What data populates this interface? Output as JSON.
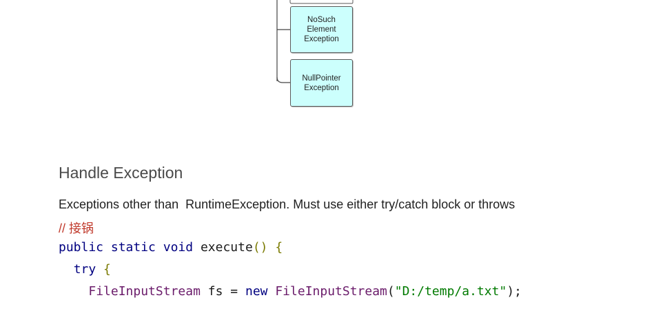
{
  "diagram": {
    "nodes": [
      {
        "label": "NoSuch\nElement\nException"
      },
      {
        "label": "NullPointer\nException"
      }
    ]
  },
  "section": {
    "heading": "Handle Exception",
    "description": "Exceptions other than  RuntimeException. Must use either try/catch block or throws",
    "comment": "// 接锅"
  },
  "code": {
    "line1": {
      "kw1": "public",
      "kw2": "static",
      "kw3": "void",
      "name": "execute",
      "parens": "()",
      "brace": "{"
    },
    "line2": {
      "kw": "try",
      "brace": "{"
    },
    "line3": {
      "type1": "FileInputStream",
      "var": "fs",
      "eq": "=",
      "kw": "new",
      "type2": "FileInputStream",
      "open": "(",
      "str": "\"D:/temp/a.txt\"",
      "close": ");"
    }
  },
  "colors": {
    "node_fill": "#ccfffd",
    "node_border": "#5a5a5a",
    "keyword": "#000080",
    "type": "#6a1b6a",
    "string": "#007a00",
    "comment": "#c0392b",
    "heading": "#4a4a4a"
  }
}
